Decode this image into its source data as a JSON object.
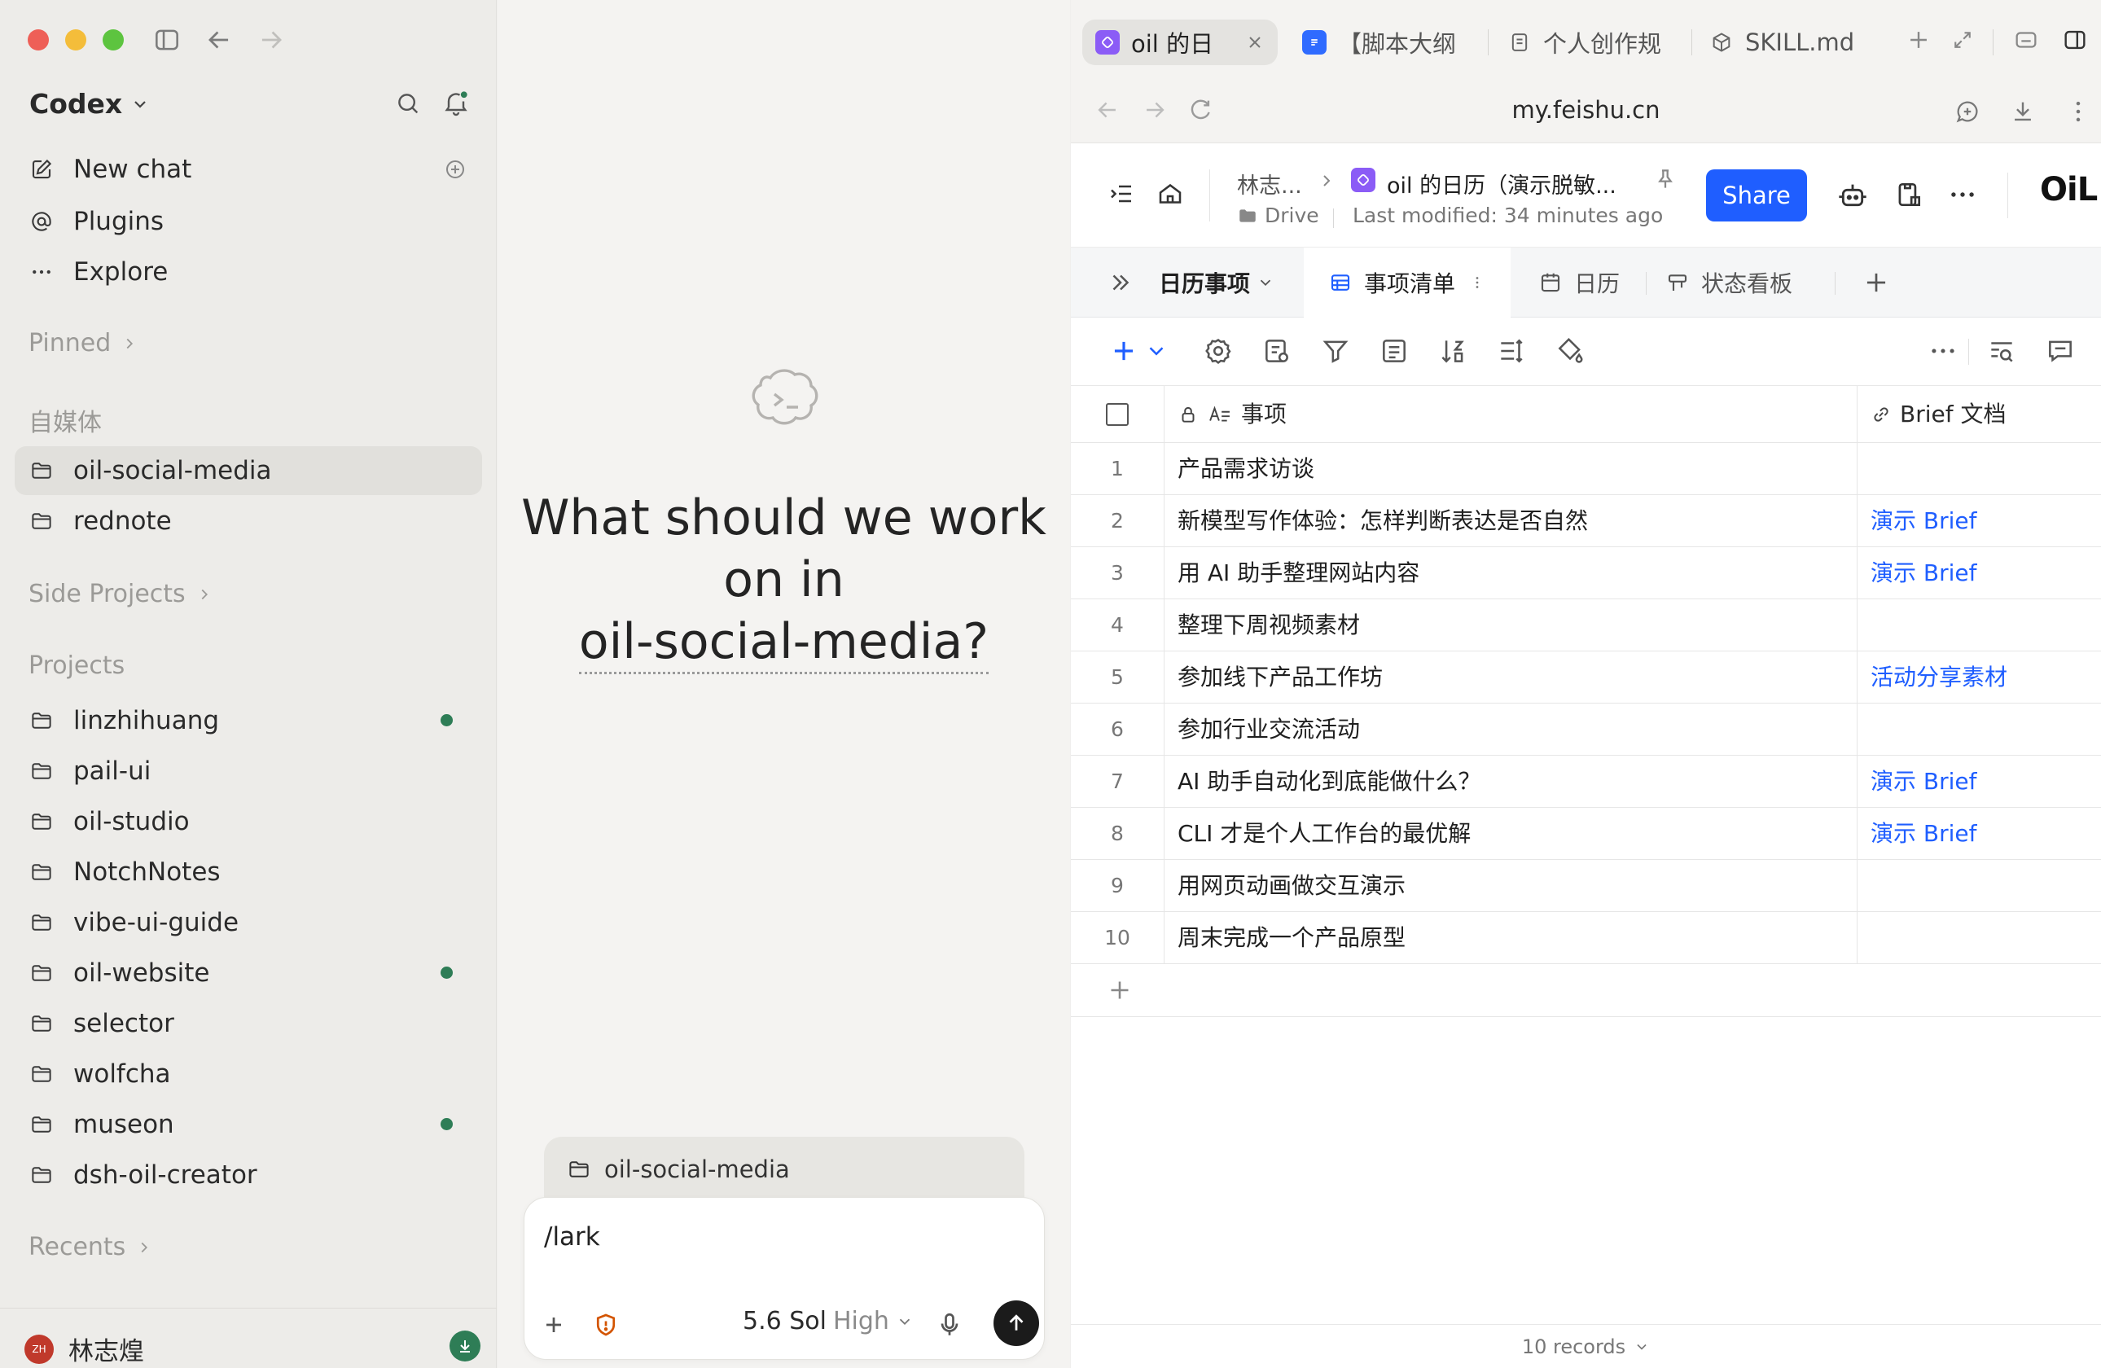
{
  "sidebar": {
    "app_name": "Codex",
    "nav": [
      {
        "label": "New chat",
        "icon": "compose-icon"
      },
      {
        "label": "Plugins",
        "icon": "at-sign-icon"
      },
      {
        "label": "Explore",
        "icon": "ellipsis-icon"
      }
    ],
    "pinned_label": "Pinned",
    "group_label": "自媒体",
    "group_items": [
      "oil-social-media",
      "rednote"
    ],
    "side_projects_label": "Side Projects",
    "projects_label": "Projects",
    "projects": [
      {
        "name": "linzhihuang",
        "status": true
      },
      {
        "name": "pail-ui",
        "status": false
      },
      {
        "name": "oil-studio",
        "status": false
      },
      {
        "name": "NotchNotes",
        "status": false
      },
      {
        "name": "vibe-ui-guide",
        "status": false
      },
      {
        "name": "oil-website",
        "status": true
      },
      {
        "name": "selector",
        "status": false
      },
      {
        "name": "wolfcha",
        "status": false
      },
      {
        "name": "museon",
        "status": true
      },
      {
        "name": "dsh-oil-creator",
        "status": false
      }
    ],
    "recents_label": "Recents",
    "user": {
      "initials": "ZH",
      "name": "林志煌"
    }
  },
  "center": {
    "hero_line1": "What should we work",
    "hero_line2": "on in",
    "hero_project": "oil-social-media?",
    "context_chip": "oil-social-media",
    "composer_text": "/lark",
    "model_name": "5.6 Sol",
    "model_level": "High"
  },
  "browser": {
    "tabs": [
      {
        "label": "oil 的日",
        "active": true
      },
      {
        "label": "【脚本大纲"
      },
      {
        "label": "个人创作规"
      },
      {
        "label": "SKILL.md"
      }
    ],
    "url": "my.feishu.cn"
  },
  "doc": {
    "breadcrumb_owner": "林志...",
    "title": "oil 的日历（演示脱敏...",
    "location": "Drive",
    "modified": "Last modified: 34 minutes ago",
    "share_label": "Share",
    "logo_text": "OiL",
    "table_name": "日历事项",
    "views": [
      "事项清单",
      "日历",
      "状态看板"
    ],
    "columns": {
      "item": "事项",
      "brief": "Brief 文档"
    },
    "rows": [
      {
        "n": "1",
        "item": "产品需求访谈",
        "brief": ""
      },
      {
        "n": "2",
        "item": "新模型写作体验：怎样判断表达是否自然",
        "brief": "演示 Brief"
      },
      {
        "n": "3",
        "item": "用 AI 助手整理网站内容",
        "brief": "演示 Brief"
      },
      {
        "n": "4",
        "item": "整理下周视频素材",
        "brief": ""
      },
      {
        "n": "5",
        "item": "参加线下产品工作坊",
        "brief": "活动分享素材"
      },
      {
        "n": "6",
        "item": "参加行业交流活动",
        "brief": ""
      },
      {
        "n": "7",
        "item": "AI 助手自动化到底能做什么？",
        "brief": "演示 Brief"
      },
      {
        "n": "8",
        "item": "CLI 才是个人工作台的最优解",
        "brief": "演示 Brief"
      },
      {
        "n": "9",
        "item": "用网页动画做交互演示",
        "brief": ""
      },
      {
        "n": "10",
        "item": "周末完成一个产品原型",
        "brief": ""
      }
    ],
    "records_label": "10 records"
  },
  "colors": {
    "accent": "#1f5eff",
    "status_dot": "#2e7d56",
    "app_icon": "#8b5cf6"
  }
}
